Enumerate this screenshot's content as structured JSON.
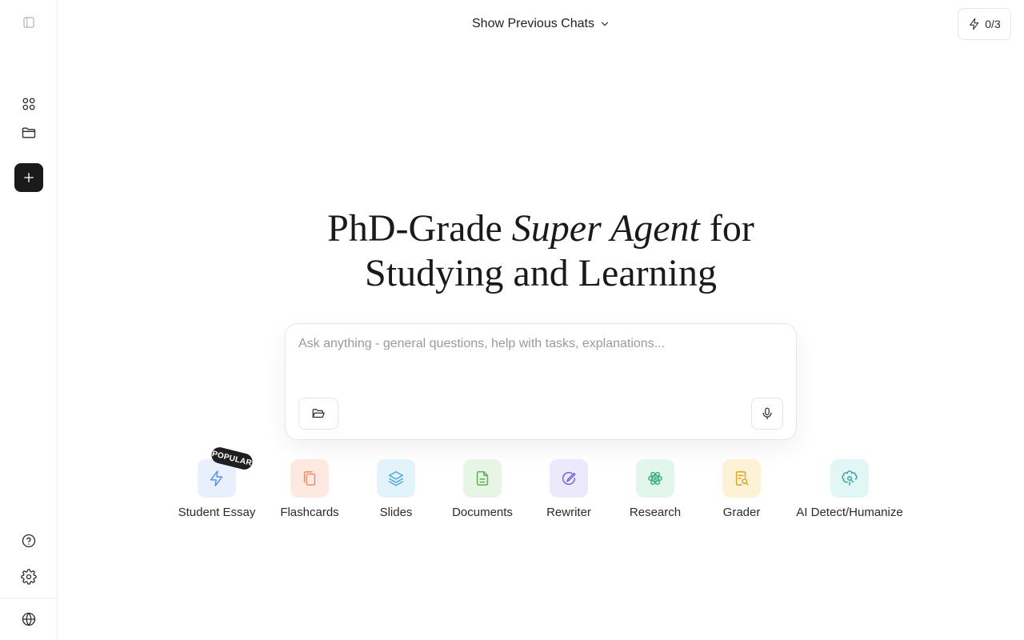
{
  "top_bar": {
    "previous_chats_label": "Show Previous Chats",
    "credits_label": "0/3"
  },
  "headline": {
    "line1_prefix": "PhD-Grade ",
    "line1_emphasis": "Super Agent",
    "line1_suffix": " for",
    "line2": "Studying and Learning"
  },
  "prompt": {
    "placeholder": "Ask anything - general questions, help with tasks, explanations..."
  },
  "tools": [
    {
      "label": "Student Essay",
      "badge": "POPULAR",
      "icon": "bolt-icon",
      "bg": "#e8f0fe",
      "fg": "#5b8def"
    },
    {
      "label": "Flashcards",
      "icon": "cards-icon",
      "bg": "#fde9e2",
      "fg": "#ef8a62"
    },
    {
      "label": "Slides",
      "icon": "layers-icon",
      "bg": "#e3f3fb",
      "fg": "#4aa8d8"
    },
    {
      "label": "Documents",
      "icon": "document-icon",
      "bg": "#e7f6e4",
      "fg": "#5aae54"
    },
    {
      "label": "Rewriter",
      "icon": "rewrite-icon",
      "bg": "#ebe9fb",
      "fg": "#6d63d9"
    },
    {
      "label": "Research",
      "icon": "atom-icon",
      "bg": "#e2f6ee",
      "fg": "#3fb07f"
    },
    {
      "label": "Grader",
      "icon": "grader-icon",
      "bg": "#fdf2d6",
      "fg": "#d9a521"
    },
    {
      "label": "AI Detect/Humanize",
      "icon": "brain-icon",
      "bg": "#e2f6f6",
      "fg": "#38a6a6"
    }
  ],
  "colors": {
    "new_button": "#1a1a1a",
    "border": "#ececec"
  }
}
